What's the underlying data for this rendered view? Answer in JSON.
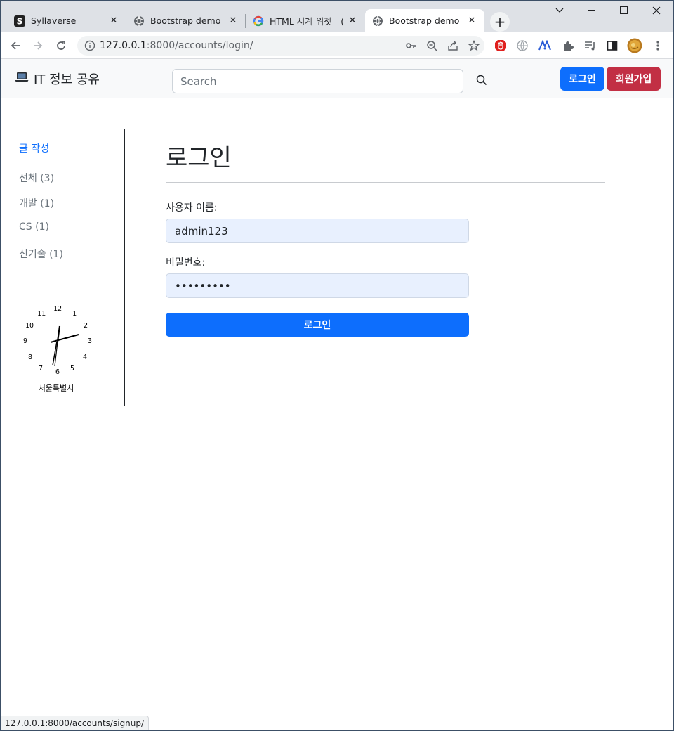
{
  "browser": {
    "tabs": [
      {
        "title": "Syllaverse",
        "favicon": "s-logo-icon",
        "active": false
      },
      {
        "title": "Bootstrap demo",
        "favicon": "globe-icon",
        "active": false
      },
      {
        "title": "HTML 시계 위젯 - (",
        "favicon": "google-icon",
        "active": false
      },
      {
        "title": "Bootstrap demo",
        "favicon": "globe-icon",
        "active": true
      }
    ],
    "url_host": "127.0.0.1",
    "url_path": ":8000/accounts/login/",
    "status_url": "127.0.0.1:8000/accounts/signup/"
  },
  "navbar": {
    "brand": "IT 정보 공유",
    "brand_icon": "laptop-icon",
    "search_placeholder": "Search",
    "login_label": "로그인",
    "signup_label": "회원가입",
    "colors": {
      "login": "#0d6efd",
      "signup": "#c22f44"
    }
  },
  "sidebar": {
    "write_label": "글 작성",
    "categories": [
      {
        "label": "전체 (3)"
      },
      {
        "label": "개발 (1)"
      },
      {
        "label": "CS (1)"
      },
      {
        "label": "신기술 (1)"
      }
    ],
    "clock": {
      "city": "서울특별시",
      "numbers": [
        "12",
        "1",
        "2",
        "3",
        "4",
        "5",
        "6",
        "7",
        "8",
        "9",
        "10",
        "11"
      ]
    }
  },
  "login_form": {
    "title": "로그인",
    "username_label": "사용자 이름:",
    "username_value": "admin123",
    "password_label": "비밀번호:",
    "password_value": "•••••••••",
    "submit_label": "로그인"
  }
}
